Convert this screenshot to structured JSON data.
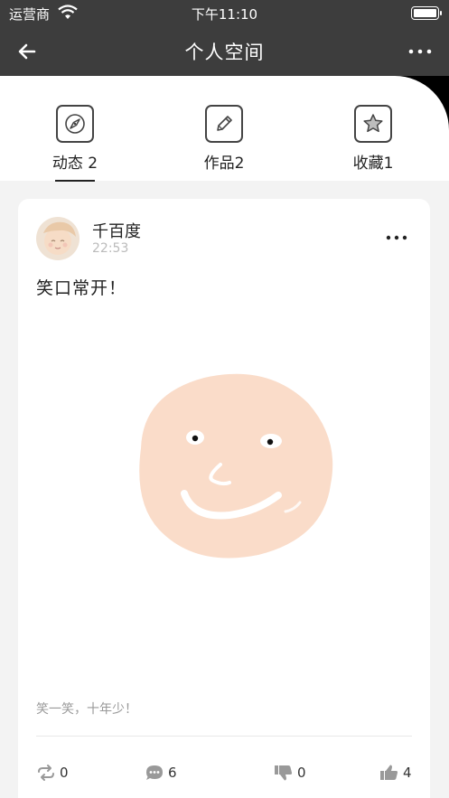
{
  "status_bar": {
    "carrier": "运营商",
    "time": "下午11:10"
  },
  "nav": {
    "title": "个人空间"
  },
  "tabs": [
    {
      "label": "动态 2",
      "icon": "compass-icon",
      "active": true
    },
    {
      "label": "作品2",
      "icon": "pencil-icon",
      "active": false
    },
    {
      "label": "收藏1",
      "icon": "star-icon",
      "active": false
    }
  ],
  "post": {
    "username": "千百度",
    "time": "22:53",
    "text": "笑口常开！",
    "caption": "笑一笑，十年少！",
    "actions": {
      "forward_count": "0",
      "comment_count": "6",
      "dislike_count": "0",
      "like_count": "4"
    }
  },
  "colors": {
    "header_bg": "#3d3d3d",
    "face_color": "#fadcc9",
    "page_bg": "#f3f3f3"
  }
}
